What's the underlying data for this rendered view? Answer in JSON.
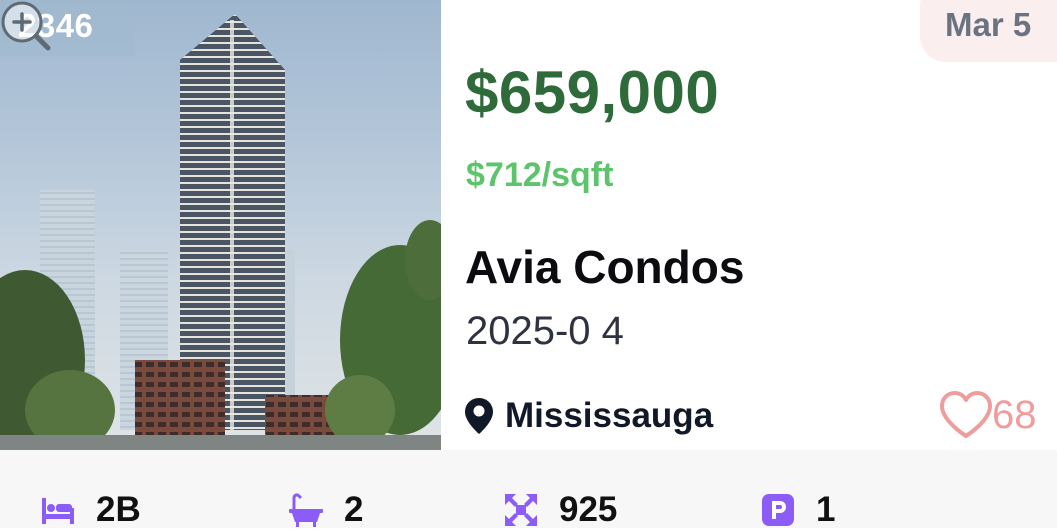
{
  "listing": {
    "id": "2346",
    "listed_date": "Mar 5",
    "price": "$659,000",
    "price_per_sqft": "$712/sqft",
    "name": "Avia Condos",
    "occupancy": "2025-0 4",
    "location": "Mississauga",
    "likes": "68"
  },
  "stats": [
    {
      "icon": "bed-icon",
      "value": "2B"
    },
    {
      "icon": "bathtub-icon",
      "value": "2"
    },
    {
      "icon": "area-expand-icon",
      "value": "925"
    },
    {
      "icon": "parking-icon",
      "value": "1"
    }
  ],
  "colors": {
    "price": "#2f6b3a",
    "price_per_sqft": "#5cc46a",
    "accent_icons": "#8b5cf6",
    "heart": "#ef9c9c",
    "date_pill": "#fbeeee"
  }
}
